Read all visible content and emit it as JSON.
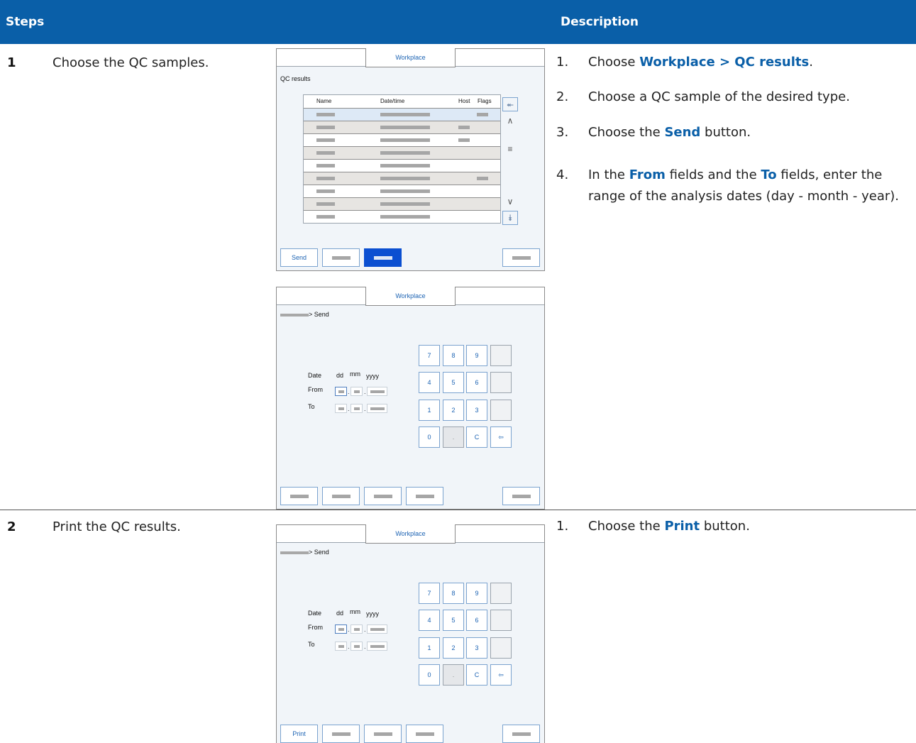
{
  "header": {
    "steps": "Steps",
    "description": "Description"
  },
  "steps": [
    {
      "number": "1",
      "title": "Choose the QC samples.",
      "instructions": [
        {
          "num": "1.",
          "pre": "Choose ",
          "hl": "Workplace > QC results",
          "post": "."
        },
        {
          "num": "2.",
          "text": "Choose a QC sample of the desired type."
        },
        {
          "num": "3.",
          "pre": "Choose the ",
          "hl": "Send",
          "post": " button."
        },
        {
          "num": "4.",
          "pre": "In the ",
          "hl": "From",
          "mid": " fields and the ",
          "hl2": "To",
          "post": " fields, enter the range of the analysis dates (day - month - year)."
        }
      ]
    },
    {
      "number": "2",
      "title": "Print the QC results.",
      "instructions": [
        {
          "num": "1.",
          "pre": "Choose the ",
          "hl": "Print",
          "post": " button."
        }
      ]
    }
  ],
  "screens": {
    "tab_label": "Workplace",
    "qc": {
      "title": "QC results",
      "columns": {
        "name": "Name",
        "datetime": "Date/time",
        "host": "Host",
        "flags": "Flags"
      },
      "send_button": "Send"
    },
    "send": {
      "crumb_suffix": "> Send",
      "date_label": "Date",
      "format_dd": "dd",
      "format_mm": "mm",
      "format_yyyy": "yyyy",
      "from_label": "From",
      "to_label": "To",
      "keypad": [
        "7",
        "8",
        "9",
        "4",
        "5",
        "6",
        "1",
        "2",
        "3",
        "0",
        ".",
        "C",
        "⇦"
      ],
      "print_button": "Print"
    }
  }
}
